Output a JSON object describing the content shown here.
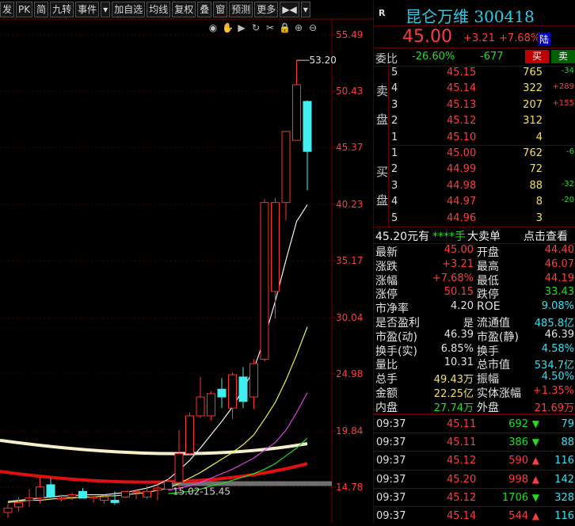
{
  "toolbar": {
    "items": [
      "发",
      "PK",
      "简",
      "九转",
      "事件",
      "▾",
      "加自选",
      "均线",
      "复权",
      "叠",
      "窗",
      "预测",
      "更多",
      "▶◀",
      "▾"
    ]
  },
  "tools": [
    "eye-icon",
    "hand-icon",
    "play-icon",
    "refresh-icon",
    "scissors-icon",
    "lock-icon",
    "zoom-in-icon",
    "zoom-out-icon"
  ],
  "chart": {
    "price_labels": [
      "55.49",
      "50.43",
      "45.37",
      "40.23",
      "35.17",
      "30.04",
      "24.98",
      "19.84",
      "14.78"
    ],
    "high_marker": "53.20",
    "range_label": "15.02-15.45"
  },
  "chart_data": {
    "type": "candlestick",
    "y_axis": {
      "ticks": [
        55.49,
        50.43,
        45.37,
        40.23,
        35.17,
        30.04,
        24.98,
        19.84,
        14.78
      ],
      "range": [
        11.5,
        57.5
      ]
    },
    "candles": [
      {
        "o": 12.9,
        "h": 13.3,
        "l": 12.0,
        "c": 12.5,
        "color": "red"
      },
      {
        "o": 13.4,
        "h": 13.9,
        "l": 12.6,
        "c": 13.0,
        "color": "red"
      },
      {
        "o": 13.6,
        "h": 14.6,
        "l": 13.0,
        "c": 13.8,
        "color": "red"
      },
      {
        "o": 13.8,
        "h": 15.7,
        "l": 13.3,
        "c": 14.8,
        "color": "red"
      },
      {
        "o": 15.0,
        "h": 15.6,
        "l": 13.8,
        "c": 13.9,
        "color": "cyan"
      },
      {
        "o": 13.8,
        "h": 14.1,
        "l": 13.5,
        "c": 13.7,
        "color": "red"
      },
      {
        "o": 14.1,
        "h": 14.3,
        "l": 13.6,
        "c": 13.9,
        "color": "red"
      },
      {
        "o": 14.4,
        "h": 14.7,
        "l": 13.9,
        "c": 13.8,
        "color": "cyan"
      },
      {
        "o": 13.8,
        "h": 14.0,
        "l": 13.4,
        "c": 13.9,
        "color": "red"
      },
      {
        "o": 13.9,
        "h": 14.1,
        "l": 13.3,
        "c": 13.6,
        "color": "red"
      },
      {
        "o": 13.6,
        "h": 14.4,
        "l": 13.2,
        "c": 13.4,
        "color": "cyan"
      },
      {
        "o": 13.9,
        "h": 14.4,
        "l": 13.8,
        "c": 14.4,
        "color": "red"
      },
      {
        "o": 14.3,
        "h": 14.6,
        "l": 13.7,
        "c": 14.4,
        "color": "red"
      },
      {
        "o": 13.9,
        "h": 14.9,
        "l": 13.7,
        "c": 14.4,
        "color": "red"
      },
      {
        "o": 14.5,
        "h": 15.0,
        "l": 13.6,
        "c": 14.7,
        "color": "red"
      },
      {
        "o": 14.6,
        "h": 15.6,
        "l": 14.5,
        "c": 15.3,
        "color": "red"
      },
      {
        "o": 15.2,
        "h": 19.9,
        "l": 14.6,
        "c": 17.8,
        "color": "red"
      },
      {
        "o": 17.8,
        "h": 21.5,
        "l": 17.6,
        "c": 21.2,
        "color": "red"
      },
      {
        "o": 21.2,
        "h": 24.7,
        "l": 21.0,
        "c": 22.9,
        "color": "red"
      },
      {
        "o": 21.2,
        "h": 23.4,
        "l": 20.8,
        "c": 23.2,
        "color": "red"
      },
      {
        "o": 22.9,
        "h": 24.6,
        "l": 21.9,
        "c": 23.6,
        "color": "cyan"
      },
      {
        "o": 21.9,
        "h": 25.1,
        "l": 20.9,
        "c": 24.9,
        "color": "red"
      },
      {
        "o": 24.7,
        "h": 25.6,
        "l": 21.9,
        "c": 22.5,
        "color": "cyan"
      },
      {
        "o": 22.9,
        "h": 26.3,
        "l": 21.8,
        "c": 25.9,
        "color": "red"
      },
      {
        "o": 26.3,
        "h": 40.7,
        "l": 26.1,
        "c": 40.4,
        "color": "red"
      },
      {
        "o": 40.4,
        "h": 40.8,
        "l": 30.0,
        "c": 32.4,
        "color": "red"
      },
      {
        "o": 40.4,
        "h": 46.8,
        "l": 38.8,
        "c": 46.8,
        "color": "red"
      },
      {
        "o": 46.0,
        "h": 53.2,
        "l": 46.0,
        "c": 51.0,
        "color": "red"
      },
      {
        "o": 49.5,
        "h": 49.6,
        "l": 41.5,
        "c": 45.0,
        "color": "cyan"
      }
    ],
    "moving_averages": [
      {
        "color": "white",
        "points": [
          13.5,
          13.6,
          13.7,
          13.8,
          13.9,
          14.0,
          14.0,
          14.1,
          14.1,
          14.1,
          14.2,
          14.3,
          14.5,
          14.7,
          15.0,
          15.5,
          16.3,
          17.2,
          18.3,
          19.5,
          20.7,
          22.0,
          23.6,
          25.4,
          28.2,
          31.5,
          35.2,
          38.7,
          40.2
        ]
      },
      {
        "color": "yellow",
        "points": [
          13.4,
          13.5,
          13.6,
          13.6,
          13.7,
          13.8,
          13.8,
          13.9,
          13.9,
          14.0,
          14.0,
          14.1,
          14.2,
          14.3,
          14.5,
          14.7,
          15.1,
          15.6,
          16.1,
          16.7,
          17.3,
          17.9,
          18.6,
          19.5,
          20.9,
          22.4,
          24.4,
          26.7,
          29.2
        ]
      },
      {
        "color": "magenta",
        "points": [
          null,
          null,
          null,
          null,
          null,
          null,
          null,
          null,
          null,
          null,
          null,
          null,
          null,
          null,
          null,
          14.5,
          14.7,
          14.9,
          15.2,
          15.6,
          16.0,
          16.4,
          16.9,
          17.4,
          18.1,
          18.8,
          19.9,
          21.5,
          23.3
        ]
      },
      {
        "color": "green",
        "points": [
          null,
          null,
          null,
          null,
          null,
          null,
          null,
          null,
          null,
          null,
          null,
          null,
          null,
          null,
          null,
          14.2,
          14.3,
          14.4,
          14.6,
          14.9,
          15.1,
          15.4,
          15.7,
          16.0,
          16.4,
          16.9,
          17.6,
          18.3,
          19.2
        ]
      }
    ],
    "horizontal_bands": [
      {
        "name": "cream",
        "start": 19.0,
        "mid": 17.6,
        "end": 18.7
      },
      {
        "name": "red",
        "start": 16.2,
        "mid": 14.8,
        "end": 16.9
      },
      {
        "name": "gray",
        "y": 15.1
      }
    ]
  },
  "stock": {
    "badge": "R",
    "title": "昆仑万维 300418",
    "last": "45.00",
    "change": "+3.21",
    "change_pct": "+7.68%",
    "lu_tag": "陆"
  },
  "weibi": {
    "label": "委比",
    "pct": "-26.60%",
    "diff": "-677",
    "buy": "买",
    "sell": "卖"
  },
  "sell_side_label": [
    "卖",
    "盘"
  ],
  "buy_side_label": [
    "买",
    "盘"
  ],
  "asks": [
    {
      "lvl": "5",
      "price": "45.15",
      "vol": "765",
      "delta": "-34"
    },
    {
      "lvl": "4",
      "price": "45.14",
      "vol": "322",
      "delta": "+289"
    },
    {
      "lvl": "3",
      "price": "45.13",
      "vol": "207",
      "delta": "+155"
    },
    {
      "lvl": "2",
      "price": "45.12",
      "vol": "312",
      "delta": ""
    },
    {
      "lvl": "1",
      "price": "45.10",
      "vol": "4",
      "delta": ""
    }
  ],
  "bids": [
    {
      "lvl": "1",
      "price": "45.00",
      "vol": "762",
      "delta": "-6"
    },
    {
      "lvl": "2",
      "price": "44.99",
      "vol": "72",
      "delta": ""
    },
    {
      "lvl": "3",
      "price": "44.98",
      "vol": "88",
      "delta": "-32"
    },
    {
      "lvl": "4",
      "price": "44.97",
      "vol": "8",
      "delta": "-20"
    },
    {
      "lvl": "5",
      "price": "44.96",
      "vol": "3",
      "delta": ""
    }
  ],
  "bigorder": {
    "left": "45.20元有",
    "mid": "****手",
    "mid2": "大卖单",
    "right": "点击查看"
  },
  "stats": [
    {
      "l1": "最新",
      "v1": "45.00",
      "l2": "开盘",
      "v2": "44.40"
    },
    {
      "l1": "涨跌",
      "v1": "+3.21",
      "l2": "最高",
      "v2": "46.07"
    },
    {
      "l1": "涨幅",
      "v1": "+7.68%",
      "l2": "最低",
      "v2": "44.19"
    },
    {
      "l1": "涨停",
      "v1": "50.15",
      "l2": "跌停",
      "v2": "33.43"
    },
    {
      "l1": "市净率",
      "v1": "4.20",
      "l2": "ROE",
      "v2": "9.08%"
    },
    {
      "l1": "是否盈利",
      "v1": "是",
      "l2": "流通值",
      "v2": "485.8亿"
    },
    {
      "l1": "市盈(动)",
      "v1": "46.39",
      "l2": "市盈(静)",
      "v2": "46.39"
    },
    {
      "l1": "换手(实)",
      "v1": "6.85%",
      "l2": "换手",
      "v2": "4.58%"
    },
    {
      "l1": "量比",
      "v1": "10.31",
      "l2": "总市值",
      "v2": "534.7亿"
    },
    {
      "l1": "总手",
      "v1": "49.43万",
      "l2": "振幅",
      "v2": "4.50%"
    },
    {
      "l1": "金额",
      "v1": "22.25亿",
      "l2": "实体涨幅",
      "v2": "+1.35%"
    },
    {
      "l1": "内盘",
      "v1": "27.74万",
      "l2": "外盘",
      "v2": "21.69万"
    }
  ],
  "ticks": [
    {
      "time": "09:37",
      "price": "45.11",
      "vol": "692",
      "dir": "down",
      "num": "79"
    },
    {
      "time": "09:37",
      "price": "45.11",
      "vol": "386",
      "dir": "down",
      "num": "88"
    },
    {
      "time": "09:37",
      "price": "45.12",
      "vol": "590",
      "dir": "up",
      "num": "116"
    },
    {
      "time": "09:37",
      "price": "45.20",
      "vol": "998",
      "dir": "up",
      "num": "142"
    },
    {
      "time": "09:37",
      "price": "45.12",
      "vol": "1706",
      "dir": "down",
      "num": "328"
    },
    {
      "time": "09:37",
      "price": "45.14",
      "vol": "544",
      "dir": "up",
      "num": "116"
    }
  ]
}
